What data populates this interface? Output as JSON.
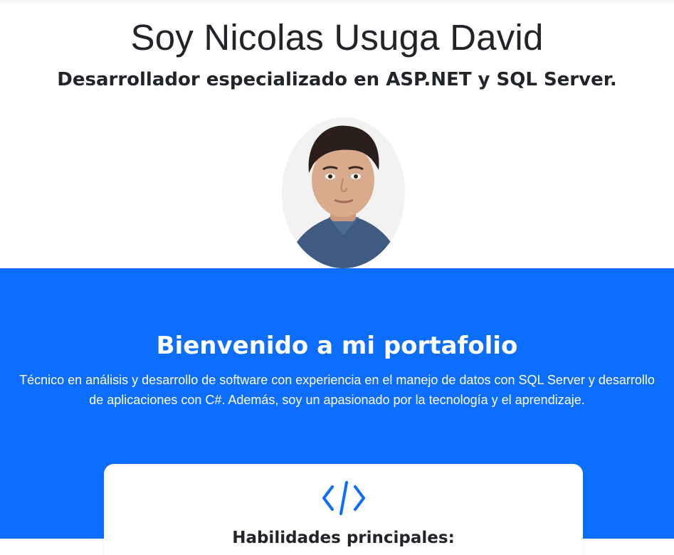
{
  "header": {
    "name": "Soy Nicolas Usuga David",
    "subtitle": "Desarrollador especializado en ASP.NET y SQL Server."
  },
  "avatar": {
    "alt": "Foto de Nicolas Usuga David"
  },
  "hero": {
    "title": "Bienvenido a mi portafolio",
    "text": "Técnico en análisis y desarrollo de software con experiencia en el manejo de datos con SQL Server y desarrollo de aplicaciones con C#. Además, soy un apasionado por la tecnología y el aprendizaje.",
    "background": "#0d6efd"
  },
  "skills": {
    "icon": "code-icon",
    "title": "Habilidades principales:",
    "icon_color": "#0d6efd"
  }
}
